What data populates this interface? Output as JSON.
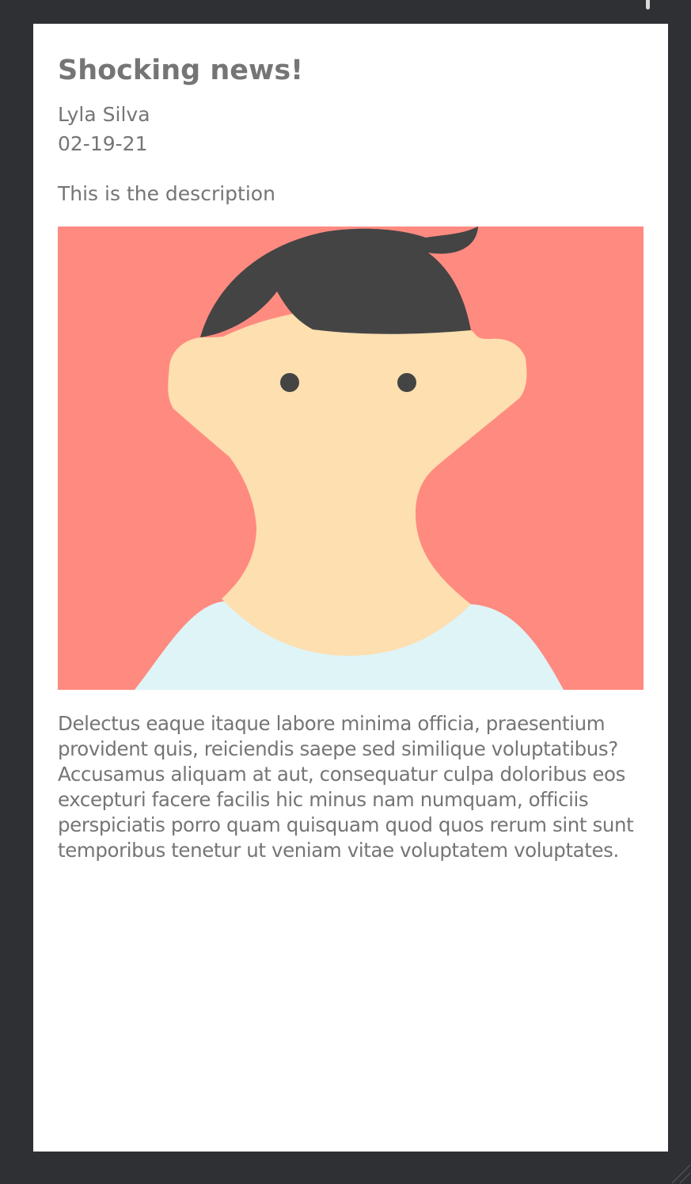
{
  "article": {
    "title": "Shocking news!",
    "author": "Lyla Silva",
    "date": "02-19-21",
    "description": "This is the description",
    "image": {
      "icon": "avatar-illustration",
      "background_color": "#ff8a80",
      "skin_color": "#fddfb0",
      "hair_color": "#444444",
      "shirt_color": "#dff4f7"
    },
    "body": "Delectus eaque itaque labore minima officia, praesentium provident quis, reiciendis saepe sed similique voluptatibus? Accusamus aliquam at aut, consequatur culpa doloribus eos excepturi facere facilis hic minus nam numquam, officiis perspiciatis porro quam quisquam quod quos rerum sint sunt temporibus tenetur ut veniam vitae voluptatem voluptates."
  },
  "theme": {
    "window_background": "#2f3033",
    "card_background": "#ffffff",
    "text_color": "#757575"
  }
}
